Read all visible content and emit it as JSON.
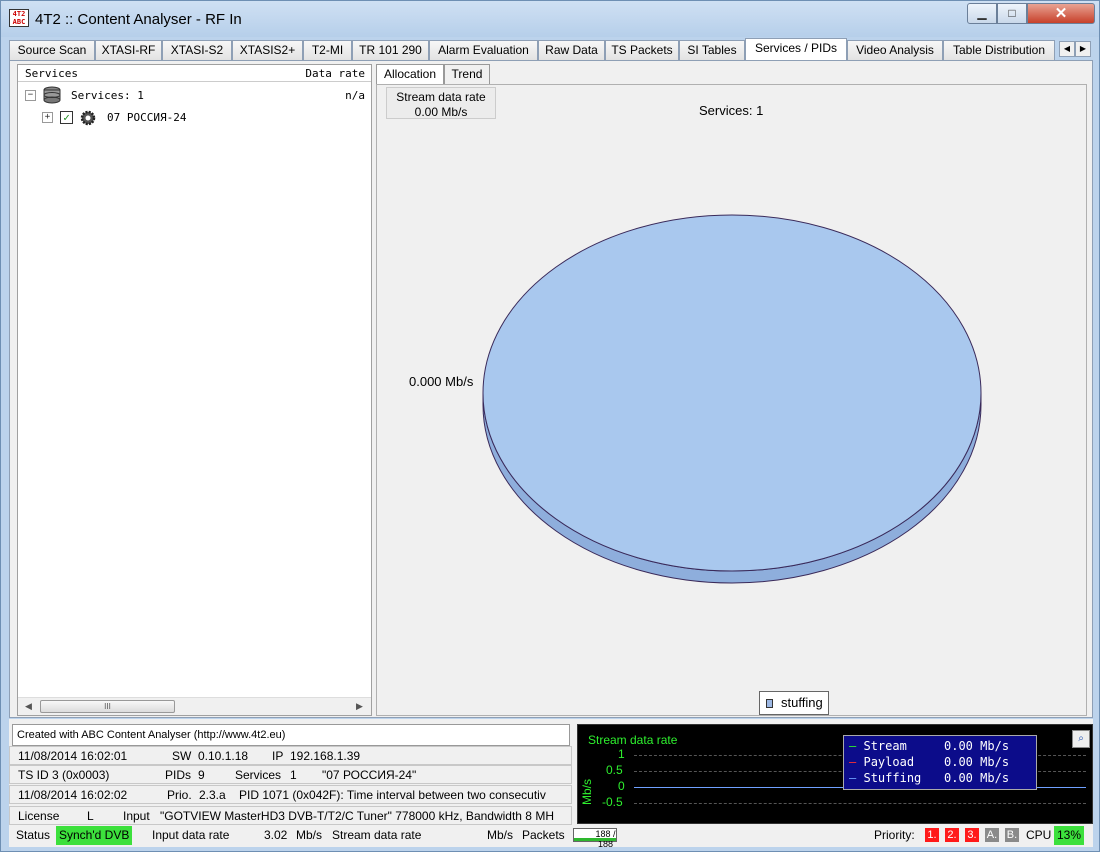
{
  "window": {
    "title": "4T2 :: Content Analyser - RF In",
    "icon_text": "4T2 ABC",
    "min": "▁",
    "max": "□",
    "close": "✕"
  },
  "tabs": [
    {
      "label": "Source Scan"
    },
    {
      "label": "XTASI-RF"
    },
    {
      "label": "XTASI-S2"
    },
    {
      "label": "XTASIS2+"
    },
    {
      "label": "T2-MI"
    },
    {
      "label": "TR 101 290"
    },
    {
      "label": "Alarm Evaluation"
    },
    {
      "label": "Raw Data"
    },
    {
      "label": "TS Packets"
    },
    {
      "label": "SI Tables"
    },
    {
      "label": "Services / PIDs"
    },
    {
      "label": "Video Analysis"
    },
    {
      "label": "Table Distribution"
    }
  ],
  "active_tab": "Services / PIDs",
  "left_panel": {
    "col_services": "Services",
    "col_rate": "Data rate",
    "root": {
      "label": "Services: 1",
      "rate": "n/a",
      "expander": "−"
    },
    "service": {
      "label": "07 РОССИЯ-24",
      "checked": "✓",
      "expander": "+"
    },
    "scroll_left": "◀",
    "scroll_right": "▶",
    "scroll_grip": "III"
  },
  "right_panel": {
    "tabs": [
      {
        "label": "Allocation"
      },
      {
        "label": "Trend"
      }
    ],
    "stream_rate_label": "Stream data rate",
    "stream_rate_value": "0.00 Mb/s",
    "services_count": "Services: 1",
    "pie_label": "0.000 Mb/s"
  },
  "chart_data": {
    "type": "pie",
    "title": "Services: 1",
    "slices": [
      {
        "label": "stuffing",
        "value": 0.0,
        "unit": "Mb/s",
        "color": "#a9c8ee"
      }
    ],
    "legend": [
      "stuffing"
    ],
    "legend_position": "bottom-center"
  },
  "bottom": {
    "created": "Created with ABC Content Analyser (http://www.4t2.eu)",
    "row1": {
      "time": "11/08/2014 16:02:01",
      "sw_label": "SW",
      "sw_value": "0.10.1.18",
      "ip_label": "IP",
      "ip_value": "192.168.1.39"
    },
    "row2": {
      "tsid": "TS ID 3 (0x0003)",
      "pids_label": "PIDs",
      "pids_value": "9",
      "services_label": "Services",
      "services_value": "1",
      "service_name": "\"07 РОССИЯ-24\""
    },
    "row3": {
      "time": "11/08/2014 16:02:02",
      "prio_label": "Prio.",
      "prio_value": "2.3.a",
      "message": "PID 1071 (0x042F): Time interval between two consecutiv"
    },
    "row4": {
      "license_label": "License",
      "license_value": "L",
      "input_label": "Input",
      "input_value": "\"GOTVIEW MasterHD3 DVB-T/T2/C Tuner\" 778000 kHz, Bandwidth 8 MH"
    }
  },
  "scope": {
    "title": "Stream data rate",
    "ylabel": "Mb/s",
    "ticks": [
      "1",
      "0.5",
      "0",
      "-0.5"
    ],
    "legend": [
      {
        "name": "Stream",
        "value": "0.00",
        "unit": "Mb/s",
        "color": "#2ef02e"
      },
      {
        "name": "Payload",
        "value": "0.00",
        "unit": "Mb/s",
        "color": "#ff3030"
      },
      {
        "name": "Stuffing",
        "value": "0.00",
        "unit": "Mb/s",
        "color": "#6fa0ff"
      }
    ],
    "zoom_icon": "⌕"
  },
  "status": {
    "status_label": "Status",
    "status_value": "Synch'd DVB",
    "input_rate_label": "Input data rate",
    "input_rate_value": "3.02",
    "input_rate_unit": "Mb/s",
    "stream_rate_label": "Stream data rate",
    "stream_rate_unit": "Mb/s",
    "packets_label": "Packets",
    "packets_value": "188 / 188",
    "priority_label": "Priority:",
    "prio1": "1.",
    "prio2": "2.",
    "prio3": "3.",
    "prioA": "A.",
    "prioB": "B.",
    "cpu_label": "CPU",
    "cpu_value": "13%"
  },
  "colors": {
    "alarm_red": "#ff1a1a",
    "ok_green": "#3ce03c",
    "inactive_gray": "#8a8a8a"
  }
}
